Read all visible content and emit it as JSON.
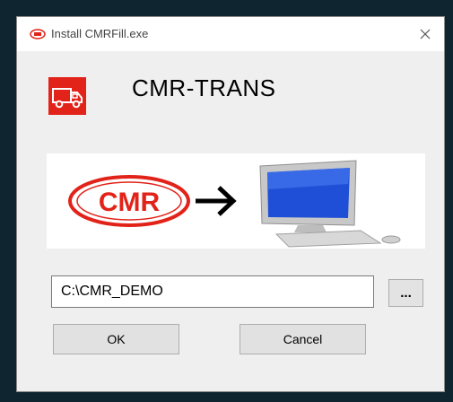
{
  "window": {
    "title": "Install CMRFill.exe",
    "app_icon": "cmr-small-logo-icon",
    "close_icon": "close-icon"
  },
  "header": {
    "logo_icon": "delivery-truck-icon",
    "title": "CMR-TRANS"
  },
  "banner": {
    "cmr_logo_text": "CMR",
    "arrow_icon": "arrow-right-icon",
    "computer_icon": "desktop-computer-icon"
  },
  "install_path": {
    "value": "C:\\CMR_DEMO",
    "browse_label": "..."
  },
  "buttons": {
    "ok_label": "OK",
    "cancel_label": "Cancel"
  },
  "colors": {
    "brand_red": "#e2231a",
    "desktop_background": "#0f2530",
    "dialog_background": "#efefef"
  }
}
